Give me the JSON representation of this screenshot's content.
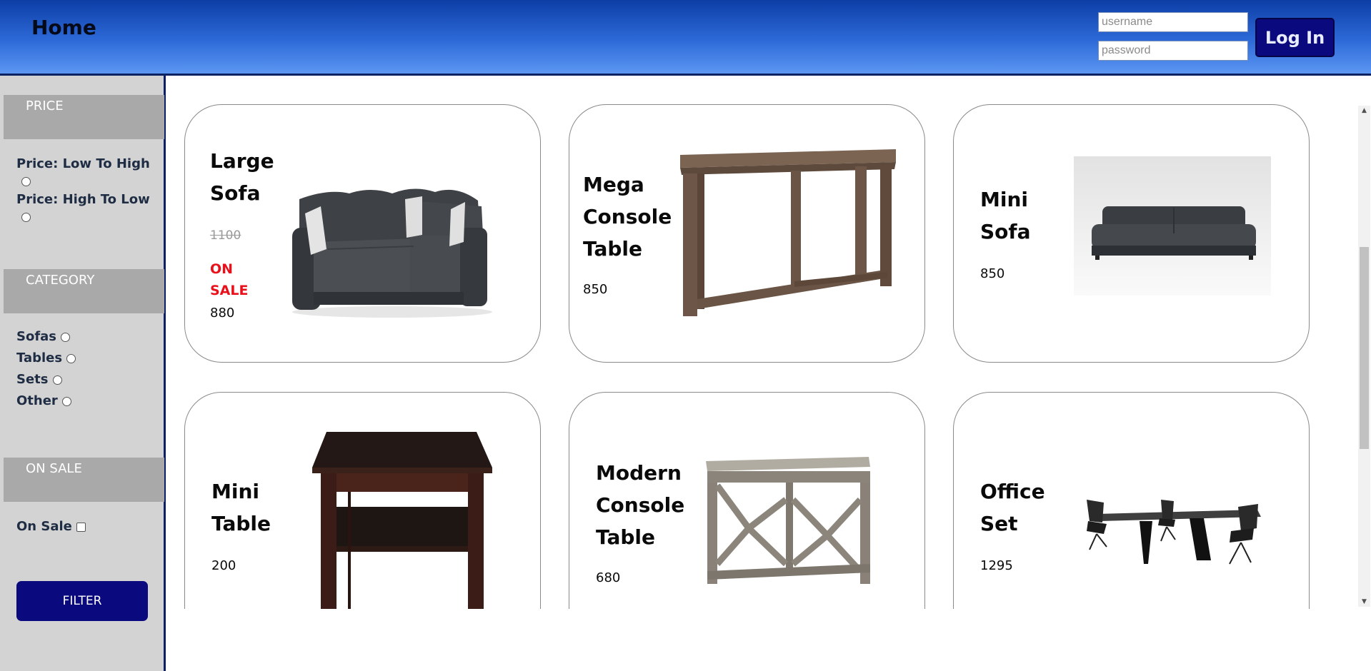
{
  "header": {
    "title": "Home",
    "username_placeholder": "username",
    "password_placeholder": "password",
    "login_label": "Log In"
  },
  "sidebar": {
    "price_heading": "PRICE",
    "price_options": [
      "Price: Low To High",
      "Price: High To Low"
    ],
    "category_heading": "CATEGORY",
    "category_options": [
      "Sofas",
      "Tables",
      "Sets",
      "Other"
    ],
    "sale_heading": "ON SALE",
    "sale_option": "On Sale",
    "filter_label": "FILTER"
  },
  "products": [
    {
      "name": "Large\nSofa",
      "original_price": "1100",
      "sale_label": "ON\nSALE",
      "price": "880",
      "icon": "sectional-sofa-image"
    },
    {
      "name": "Mega\nConsole\nTable",
      "price": "850",
      "icon": "console-table-image"
    },
    {
      "name": "Mini\nSofa",
      "price": "850",
      "icon": "sofa-image"
    },
    {
      "name": "Mini\nTable",
      "price": "200",
      "icon": "side-table-image"
    },
    {
      "name": "Modern\nConsole\nTable",
      "price": "680",
      "icon": "lattice-console-image"
    },
    {
      "name": "Office\nSet",
      "price": "1295",
      "icon": "dining-set-image"
    }
  ],
  "colors": {
    "header_top": "#0d3ea6",
    "header_bottom": "#5c97f2",
    "button": "#0a0a7e",
    "sidebar": "#d3d3d3",
    "section_head": "#a9a9a9",
    "sale": "#e8101a"
  }
}
